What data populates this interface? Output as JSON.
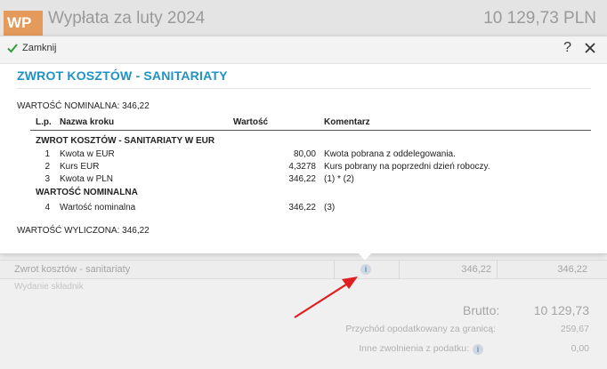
{
  "background": {
    "logo": "WP",
    "title": "Wypłata za luty 2024",
    "amount": "10 129,73 PLN",
    "row": {
      "name": "Zwrot kosztów - sanitariaty",
      "v1": "346,22",
      "v2": "346,22"
    },
    "row2": "Wydanie składnik",
    "totals": {
      "brutto_label": "Brutto:",
      "brutto_value": "10 129,73",
      "taxable_label": "Przychód opodatkowany za granicą:",
      "taxable_value": "259,67",
      "exempt_label": "Inne zwolnienia z podatku:",
      "exempt_value": "0,00"
    }
  },
  "popup": {
    "close_label": "Zamknij",
    "help": "?",
    "title": "ZWROT KOSZTÓW - SANITARIATY",
    "nominal_line": "WARTOŚĆ NOMINALNA:  346,22",
    "calc_line": "WARTOŚĆ WYLICZONA:  346,22",
    "headers": {
      "lp": "L.p.",
      "name": "Nazwa kroku",
      "value": "Wartość",
      "comment": "Komentarz"
    },
    "section1": "ZWROT KOSZTÓW - SANITARIATY W EUR",
    "section2": "WARTOŚĆ NOMINALNA",
    "rows": [
      {
        "lp": "1",
        "name": "Kwota w EUR",
        "value": "80,00",
        "comment": "Kwota pobrana z oddelegowania."
      },
      {
        "lp": "2",
        "name": "Kurs EUR",
        "value": "4,3278",
        "comment": "Kurs pobrany na poprzedni dzień roboczy."
      },
      {
        "lp": "3",
        "name": "Kwota w PLN",
        "value": "346,22",
        "comment": "(1) * (2)"
      },
      {
        "lp": "4",
        "name": "Wartość nominalna",
        "value": "346,22",
        "comment": "(3)"
      }
    ]
  },
  "colors": {
    "title": "#1f93c6",
    "arrow": "#e02020",
    "check": "#2e9e3a"
  },
  "icons": [
    "check-icon",
    "help-icon",
    "close-icon",
    "info-icon",
    "arrow-annotation"
  ]
}
